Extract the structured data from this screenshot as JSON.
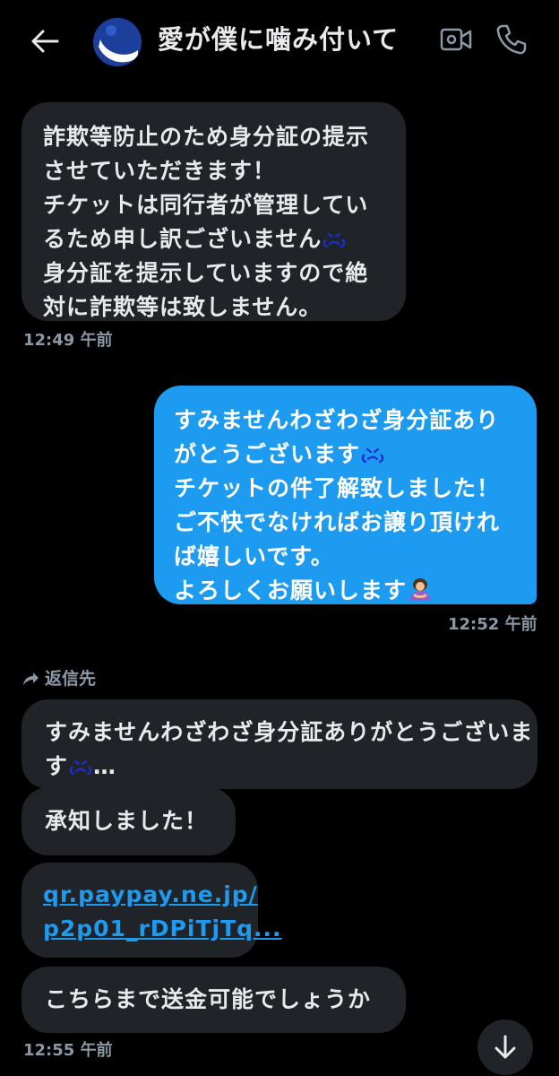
{
  "header": {
    "title": "愛が僕に噛み付いて",
    "back_icon": "back-arrow-icon",
    "video_icon": "video-call-icon",
    "call_icon": "phone-icon"
  },
  "messages": {
    "m1": {
      "lines": [
        "詐欺等防止のため身分証の提示",
        "させていただきます！",
        "チケットは同行者が管理してい",
        "るため申し訳ございません",
        "身分証を提示していますので絶",
        "対に詐欺等は致しません。"
      ],
      "time": "12:49 午前"
    },
    "m2": {
      "lines": [
        "すみませんわざわざ身分証あり",
        "がとうございます",
        "チケットの件了解致しました！",
        "ご不快でなければお譲り頂けれ",
        "ば嬉しいです。",
        "よろしくお願いします"
      ],
      "time": "12:52 午前"
    },
    "reply": {
      "label": "返信先",
      "quote_lines": [
        "すみませんわざわざ身分証ありがとうございま",
        "す"
      ],
      "ellipsis": "…"
    },
    "m3": {
      "text": "承知しました！"
    },
    "m4": {
      "link_lines": [
        "qr.paypay.ne.jp/",
        "p2p01_rDPiTjTq..."
      ]
    },
    "m5": {
      "text": "こちらまで送金可能でしょうか",
      "time": "12:55 午前"
    }
  },
  "colors": {
    "background": "#000000",
    "incoming_bubble": "#202327",
    "outgoing_bubble": "#1d9bf0",
    "link": "#1d9bf0",
    "timestamp": "#8b98a5"
  }
}
